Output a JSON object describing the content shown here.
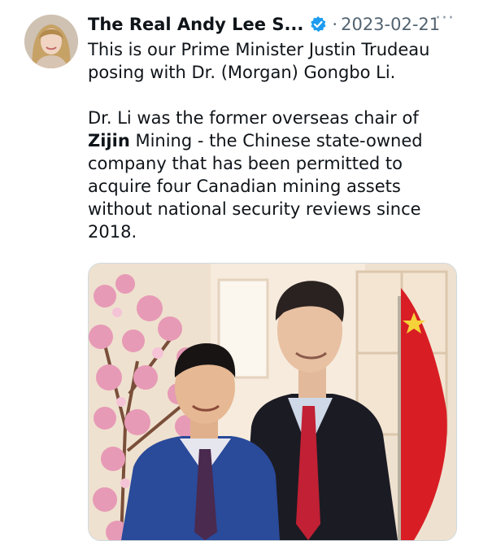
{
  "tweet": {
    "author": {
      "display_name": "The Real Andy Lee S...",
      "verified_icon": "verified-badge-icon"
    },
    "separator": "·",
    "date": "2023-02-21",
    "more_label": "···",
    "text_parts": {
      "p1": "This is our Prime Minister Justin Trudeau posing with Dr. (Morgan) Gongbo Li.",
      "p2_a": "Dr. Li was the former overseas chair of ",
      "p2_bold": "Zijin",
      "p2_b": " Mining - the Chinese state-owned company that has been permitted to acquire four Canadian mining assets without national security reviews since 2018."
    },
    "colors": {
      "verified": "#1d9bf0",
      "text": "#0f1419",
      "muted": "#536471",
      "flag": "#d81e24",
      "blossom": "#e69ab6"
    }
  }
}
